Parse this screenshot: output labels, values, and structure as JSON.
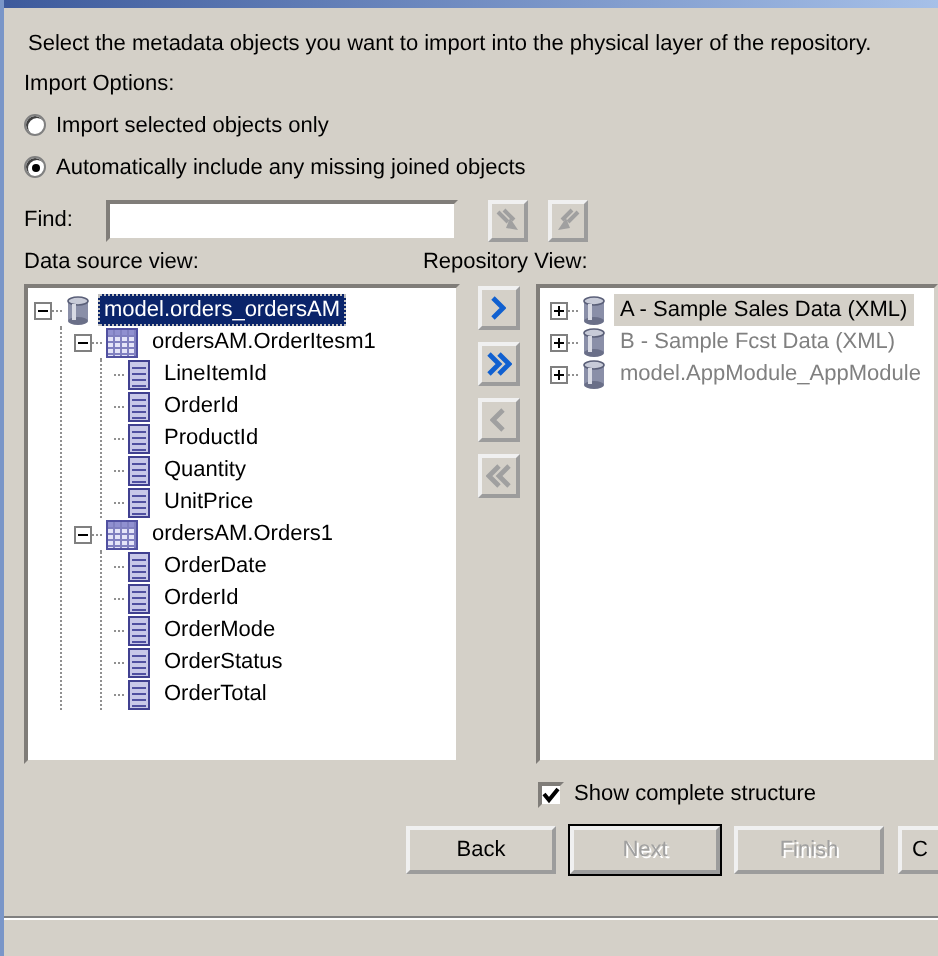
{
  "instructions": "Select the metadata objects you want to import into the physical layer of the repository.",
  "import_options": {
    "label": "Import Options:",
    "options": [
      {
        "label": "Import selected objects only",
        "selected": false
      },
      {
        "label": "Automatically include any missing joined objects",
        "selected": true
      }
    ]
  },
  "find": {
    "label": "Find:",
    "tool_buttons": [
      {
        "kind": "find-down",
        "disabled": true
      },
      {
        "kind": "find-up",
        "disabled": true
      }
    ]
  },
  "data_source_view": {
    "label": "Data source view:",
    "tree": [
      {
        "label": "model.orders_ordersAM",
        "kind": "database",
        "expanded": true,
        "selected": true,
        "children": [
          {
            "label": "ordersAM.OrderItesm1",
            "kind": "table",
            "expanded": true,
            "selected": false,
            "children": [
              {
                "label": "LineItemId",
                "kind": "column",
                "selected": false
              },
              {
                "label": "OrderId",
                "kind": "column",
                "selected": false
              },
              {
                "label": "ProductId",
                "kind": "column",
                "selected": false
              },
              {
                "label": "Quantity",
                "kind": "column",
                "selected": false
              },
              {
                "label": "UnitPrice",
                "kind": "column",
                "selected": false
              }
            ]
          },
          {
            "label": "ordersAM.Orders1",
            "kind": "table",
            "expanded": true,
            "selected": false,
            "children": [
              {
                "label": "OrderDate",
                "kind": "column",
                "selected": false
              },
              {
                "label": "OrderId",
                "kind": "column",
                "selected": false
              },
              {
                "label": "OrderMode",
                "kind": "column",
                "selected": false
              },
              {
                "label": "OrderStatus",
                "kind": "column",
                "selected": false
              },
              {
                "label": "OrderTotal",
                "kind": "column",
                "selected": false
              }
            ]
          }
        ]
      }
    ]
  },
  "transfer_buttons": [
    {
      "kind": "add",
      "disabled": false
    },
    {
      "kind": "add-all",
      "disabled": false
    },
    {
      "kind": "remove",
      "disabled": true
    },
    {
      "kind": "remove-all",
      "disabled": true
    }
  ],
  "repository_view": {
    "label": "Repository View:",
    "tree": [
      {
        "label": "A - Sample Sales Data (XML)",
        "kind": "database",
        "expanded": false,
        "selected": true,
        "disabled": false
      },
      {
        "label": "B - Sample Fcst Data (XML)",
        "kind": "database",
        "expanded": false,
        "selected": false,
        "disabled": true
      },
      {
        "label": "model.AppModule_AppModule",
        "kind": "database",
        "expanded": false,
        "selected": false,
        "disabled": true
      }
    ]
  },
  "show_complete_structure": {
    "label": "Show complete structure",
    "checked": true
  },
  "buttons": [
    {
      "label": "Back",
      "disabled": false,
      "default": false
    },
    {
      "label": "Next",
      "disabled": true,
      "default": true
    },
    {
      "label": "Finish",
      "disabled": true,
      "default": false
    },
    {
      "label": "C",
      "disabled": false,
      "default": false
    }
  ]
}
